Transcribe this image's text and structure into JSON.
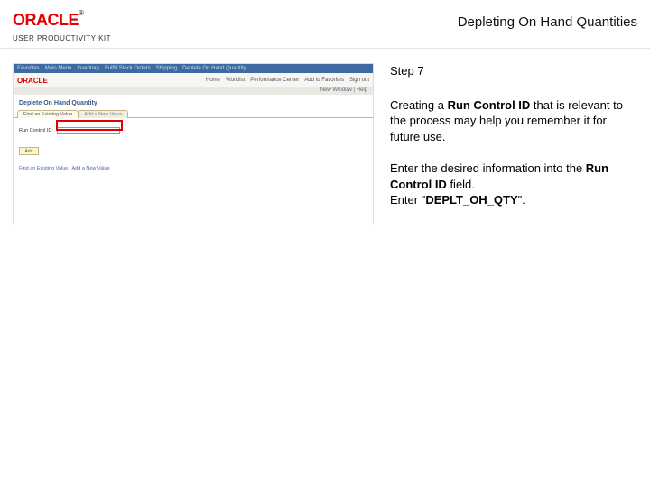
{
  "header": {
    "brand_main": "ORACLE",
    "brand_tm": "®",
    "brand_sub": "USER PRODUCTIVITY KIT",
    "title": "Depleting On Hand Quantities"
  },
  "screenshot": {
    "topbar": {
      "fav": "Favorites",
      "menu1": "Main Menu",
      "menu2": "Inventory",
      "menu3": "Fulfill Stock Orders",
      "menu4": "Shipping",
      "menu5": "Deplete On Hand Quantity"
    },
    "brandrow": {
      "logo": "ORACLE",
      "links": [
        "Home",
        "Worklist",
        "Performance Center",
        "Add to Favorites",
        "Sign out"
      ]
    },
    "subbar": "New Window | Help",
    "page_title": "Deplete On Hand Quantity",
    "tabs": {
      "active": "Find an Existing Value",
      "inactive": "Add a New Value"
    },
    "field_label": "Run Control ID:",
    "add_button": "Add",
    "footer_links": "Find an Existing Value | Add a New Value"
  },
  "instructions": {
    "step": "Step 7",
    "p1_a": "Creating a ",
    "p1_b": "Run Control ID",
    "p1_c": " that is relevant to the process may help you remember it for future use.",
    "p2_a": "Enter the desired information into the ",
    "p2_b": "Run Control ID",
    "p2_c": " field.",
    "p3_a": "Enter \"",
    "p3_b": "DEPLT_OH_QTY",
    "p3_c": "\"."
  }
}
